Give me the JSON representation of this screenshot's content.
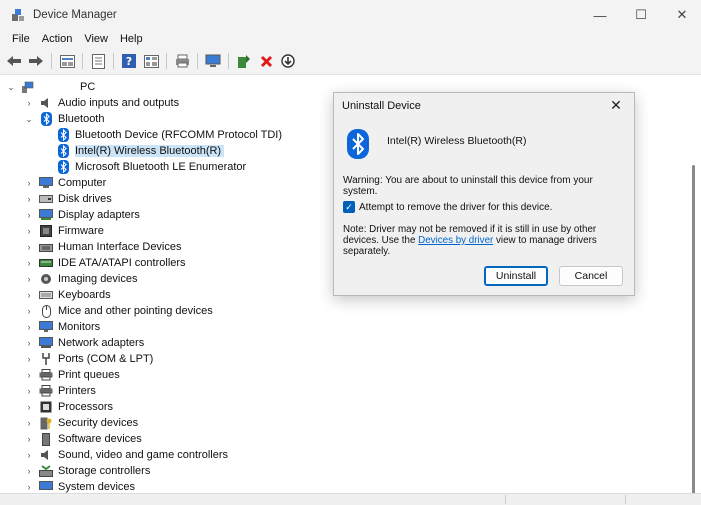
{
  "window": {
    "title": "Device Manager",
    "minimize": "—",
    "maximize": "☐",
    "close": "✕"
  },
  "menu": [
    "File",
    "Action",
    "View",
    "Help"
  ],
  "tree": {
    "root": "PC",
    "categories": [
      {
        "label": "Audio inputs and outputs",
        "icon": "speaker-icon"
      },
      {
        "label": "Bluetooth",
        "icon": "bluetooth-icon",
        "expanded": true,
        "children": [
          {
            "label": "Bluetooth Device (RFCOMM Protocol TDI)"
          },
          {
            "label": "Intel(R) Wireless Bluetooth(R)",
            "selected": true
          },
          {
            "label": "Microsoft Bluetooth LE Enumerator"
          }
        ]
      },
      {
        "label": "Computer",
        "icon": "computer-icon"
      },
      {
        "label": "Disk drives",
        "icon": "disk-drive-icon"
      },
      {
        "label": "Display adapters",
        "icon": "display-adapter-icon"
      },
      {
        "label": "Firmware",
        "icon": "firmware-icon"
      },
      {
        "label": "Human Interface Devices",
        "icon": "hid-icon"
      },
      {
        "label": "IDE ATA/ATAPI controllers",
        "icon": "ide-controller-icon"
      },
      {
        "label": "Imaging devices",
        "icon": "camera-icon"
      },
      {
        "label": "Keyboards",
        "icon": "keyboard-icon"
      },
      {
        "label": "Mice and other pointing devices",
        "icon": "mouse-icon"
      },
      {
        "label": "Monitors",
        "icon": "monitor-icon"
      },
      {
        "label": "Network adapters",
        "icon": "network-adapter-icon"
      },
      {
        "label": "Ports (COM & LPT)",
        "icon": "port-icon"
      },
      {
        "label": "Print queues",
        "icon": "print-queue-icon"
      },
      {
        "label": "Printers",
        "icon": "printer-icon"
      },
      {
        "label": "Processors",
        "icon": "processor-icon"
      },
      {
        "label": "Security devices",
        "icon": "security-device-icon"
      },
      {
        "label": "Software devices",
        "icon": "software-device-icon"
      },
      {
        "label": "Sound, video and game controllers",
        "icon": "sound-controller-icon"
      },
      {
        "label": "Storage controllers",
        "icon": "storage-controller-icon"
      },
      {
        "label": "System devices",
        "icon": "system-device-icon"
      }
    ]
  },
  "dialog": {
    "title": "Uninstall Device",
    "device": "Intel(R) Wireless Bluetooth(R)",
    "warning": "Warning: You are about to uninstall this device from your system.",
    "checkbox_label": "Attempt to remove the driver for this device.",
    "checkbox_checked": true,
    "note_before": "Note: Driver may not be removed if it is still in use by other devices. Use the ",
    "note_link": "Devices by driver",
    "note_after": " view to manage drivers separately.",
    "uninstall_label": "Uninstall",
    "cancel_label": "Cancel"
  },
  "colors": {
    "selection": "#cce4f7",
    "bluetooth": "#0a66d9",
    "primary_border": "#0067c0",
    "link": "#0066cc"
  }
}
